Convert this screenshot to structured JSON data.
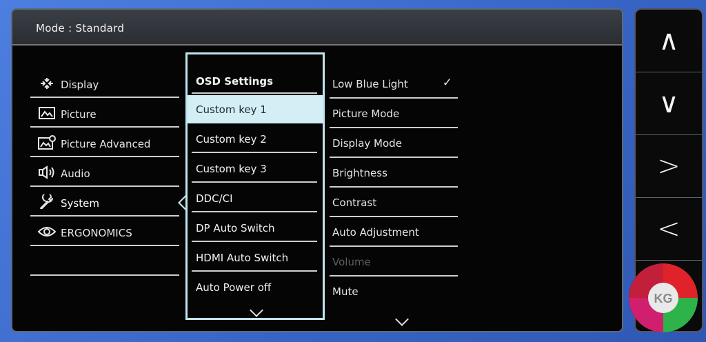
{
  "mode_bar": {
    "text": "Mode : Standard"
  },
  "categories": [
    {
      "label": "Display",
      "icon": "display-icon"
    },
    {
      "label": "Picture",
      "icon": "picture-icon"
    },
    {
      "label": "Picture Advanced",
      "icon": "picture-advanced-icon"
    },
    {
      "label": "Audio",
      "icon": "audio-icon"
    },
    {
      "label": "System",
      "icon": "system-wrench-icon",
      "active": true
    },
    {
      "label": "ERGONOMICS",
      "icon": "eye-icon"
    }
  ],
  "submenu": {
    "header": "OSD Settings",
    "items": [
      {
        "label": "Custom key 1",
        "selected": true
      },
      {
        "label": "Custom key 2"
      },
      {
        "label": "Custom key 3"
      },
      {
        "label": "DDC/CI"
      },
      {
        "label": "DP Auto Switch"
      },
      {
        "label": "HDMI Auto Switch"
      },
      {
        "label": "Auto Power off"
      }
    ]
  },
  "options": [
    {
      "label": "Low Blue Light",
      "checked": true
    },
    {
      "label": "Picture Mode"
    },
    {
      "label": "Display Mode"
    },
    {
      "label": "Brightness"
    },
    {
      "label": "Contrast"
    },
    {
      "label": "Auto Adjustment"
    },
    {
      "label": "Volume",
      "disabled": true
    },
    {
      "label": "Mute"
    }
  ],
  "checkmark": "✓",
  "keys": [
    "∧",
    "∨",
    ">",
    "<"
  ],
  "logo": {
    "text": "KG"
  },
  "colors": {
    "highlight": "#d4eef5",
    "frame": "#bfe6f0",
    "background": "#3f6fd0"
  }
}
